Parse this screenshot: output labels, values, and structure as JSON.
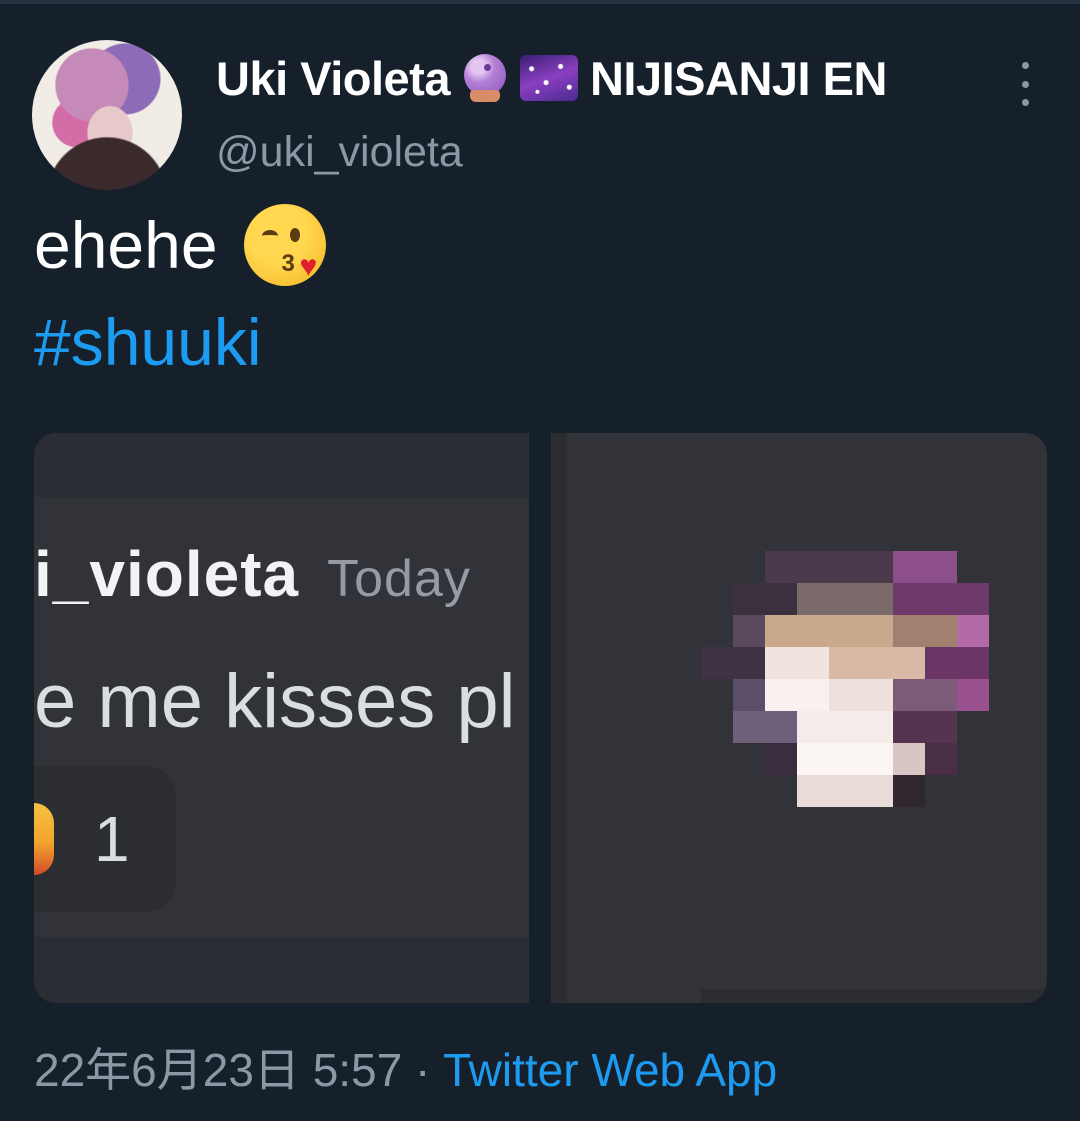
{
  "user": {
    "name": "Uki Violeta",
    "affiliation": "NIJISANJI EN",
    "handle": "@uki_violeta",
    "name_icons": [
      "crystal-ball-icon",
      "milky-way-icon"
    ]
  },
  "tweet": {
    "text": "ehehe",
    "emoji": "kissing-face-icon",
    "hashtag": "#shuuki"
  },
  "media": {
    "left_image": {
      "name_fragment": "i_violeta",
      "time_fragment": "Today",
      "message_fragment": "e me kisses pl",
      "reaction_count": "1"
    },
    "right_image": {
      "description_icon": "pixelated-sticker"
    }
  },
  "meta": {
    "date_time": "22年6月23日 5:57",
    "separator": "·",
    "source": "Twitter Web App"
  },
  "colors": {
    "background": "#15202b",
    "link": "#1d9bf0",
    "secondary_text": "#8b98a5",
    "discord_bg": "#313338"
  }
}
